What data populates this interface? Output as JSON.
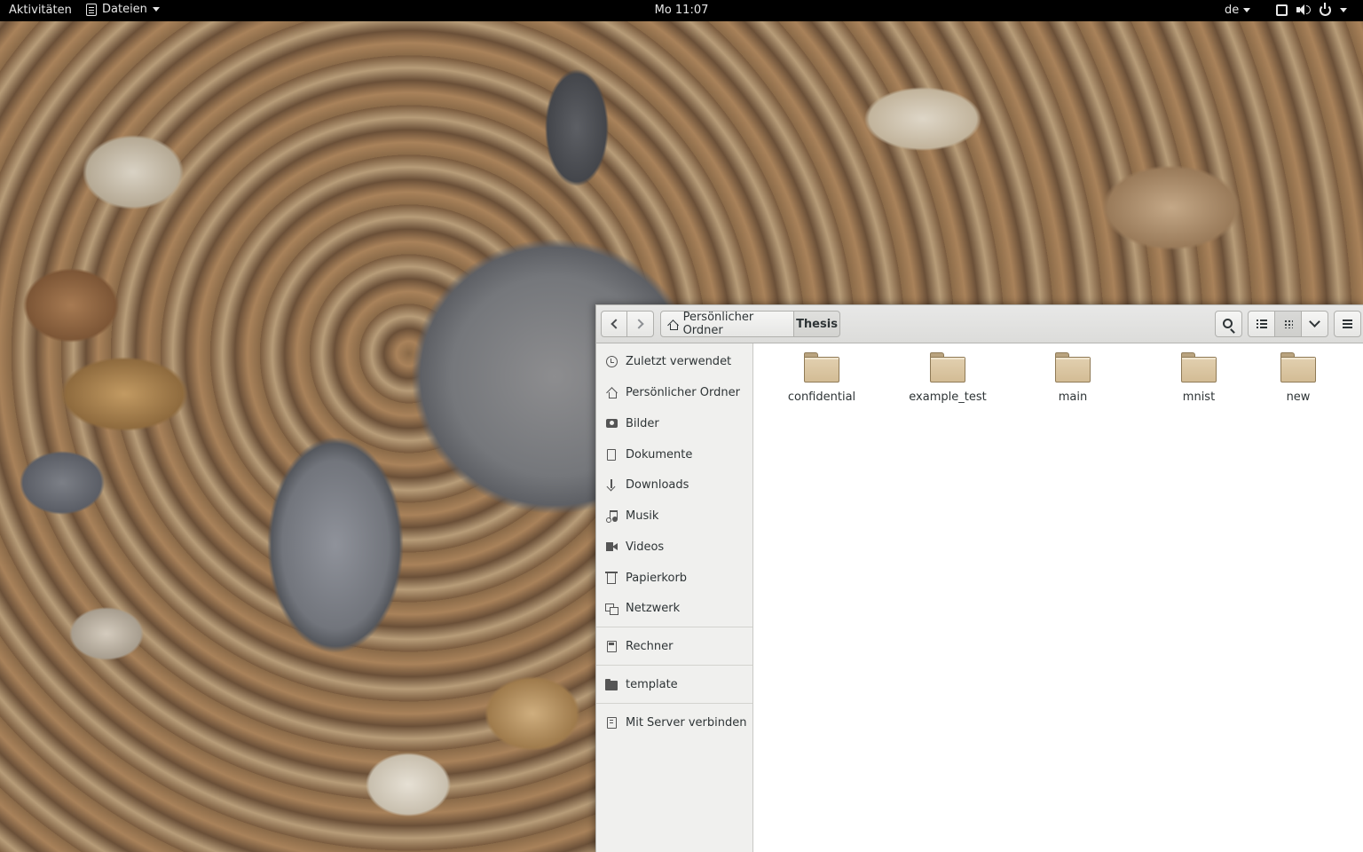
{
  "topbar": {
    "activities": "Aktivitäten",
    "app_menu": "Dateien",
    "clock": "Mo 11:07",
    "input_language": "de"
  },
  "headerbar": {
    "breadcrumb": {
      "home": "Persönlicher Ordner",
      "current": "Thesis"
    }
  },
  "sidebar": {
    "items": [
      {
        "label": "Zuletzt verwendet",
        "icon": "recent-icon"
      },
      {
        "label": "Persönlicher Ordner",
        "icon": "home-icon"
      },
      {
        "label": "Bilder",
        "icon": "camera-icon"
      },
      {
        "label": "Dokumente",
        "icon": "document-icon"
      },
      {
        "label": "Downloads",
        "icon": "download-icon"
      },
      {
        "label": "Musik",
        "icon": "music-icon"
      },
      {
        "label": "Videos",
        "icon": "video-icon"
      },
      {
        "label": "Papierkorb",
        "icon": "trash-icon"
      },
      {
        "label": "Netzwerk",
        "icon": "network-icon"
      }
    ],
    "devices": [
      {
        "label": "Rechner",
        "icon": "computer-icon"
      }
    ],
    "bookmarks": [
      {
        "label": "template",
        "icon": "folder-icon"
      }
    ],
    "connect": {
      "label": "Mit Server verbinden",
      "icon": "server-icon"
    }
  },
  "files": [
    {
      "name": "confidential",
      "icon": "folder-icon"
    },
    {
      "name": "example_test",
      "icon": "folder-icon"
    },
    {
      "name": "main",
      "icon": "folder-icon"
    },
    {
      "name": "mnist",
      "icon": "folder-icon"
    },
    {
      "name": "new",
      "icon": "folder-icon"
    }
  ],
  "colors": {
    "topbar_bg": "#000000",
    "sidebar_bg": "#f0f0ee",
    "folder_fill": "#dcc8a4"
  }
}
